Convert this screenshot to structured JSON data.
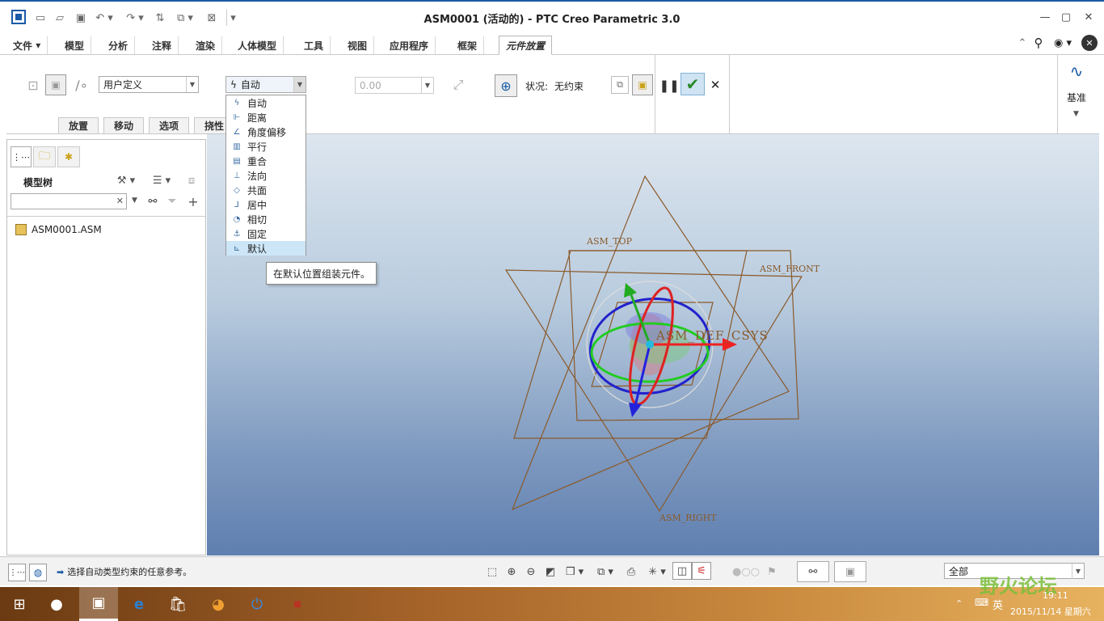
{
  "window": {
    "title": "ASM0001 (活动的) - PTC Creo Parametric 3.0"
  },
  "quick_access": [
    "new-icon",
    "open-icon",
    "save-icon",
    "undo-icon",
    "redo-icon",
    "regenerate-icon",
    "windows-icon",
    "close-window-icon",
    "customize-icon"
  ],
  "tabs": [
    "文件",
    "模型",
    "分析",
    "注释",
    "渲染",
    "人体模型",
    "工具",
    "视图",
    "应用程序",
    "框架",
    "元件放置"
  ],
  "ribbon": {
    "constraint_type": "用户定义",
    "constraint_select": "自动",
    "offset_value": "0.00",
    "status_label": "状况:",
    "status_value": "无约束",
    "datum_label": "基准"
  },
  "subtabs": [
    "放置",
    "移动",
    "选项",
    "挠性"
  ],
  "dropdown": {
    "items": [
      "自动",
      "距离",
      "角度偏移",
      "平行",
      "重合",
      "法向",
      "共面",
      "居中",
      "相切",
      "固定",
      "默认"
    ],
    "highlight_index": 10
  },
  "tooltip": "在默认位置组装元件。",
  "left_panel": {
    "title": "模型树",
    "root": "ASM0001.ASM"
  },
  "viewport": {
    "csys_label": "ASM_DEF_CSYS",
    "datum_labels": [
      "ASM_TOP",
      "ASM_FRONT",
      "ASM_RIGHT"
    ]
  },
  "status": {
    "message": "选择自动类型约束的任意参考。",
    "filter": "全部"
  },
  "taskbar": {
    "time": "19:11",
    "date": "2015/11/14 星期六",
    "ime": "英",
    "watermark": "野火论坛"
  },
  "colors": {
    "accent": "#1a5aa6",
    "highlight": "#cde6f7",
    "datum": "#8a5a2b"
  }
}
